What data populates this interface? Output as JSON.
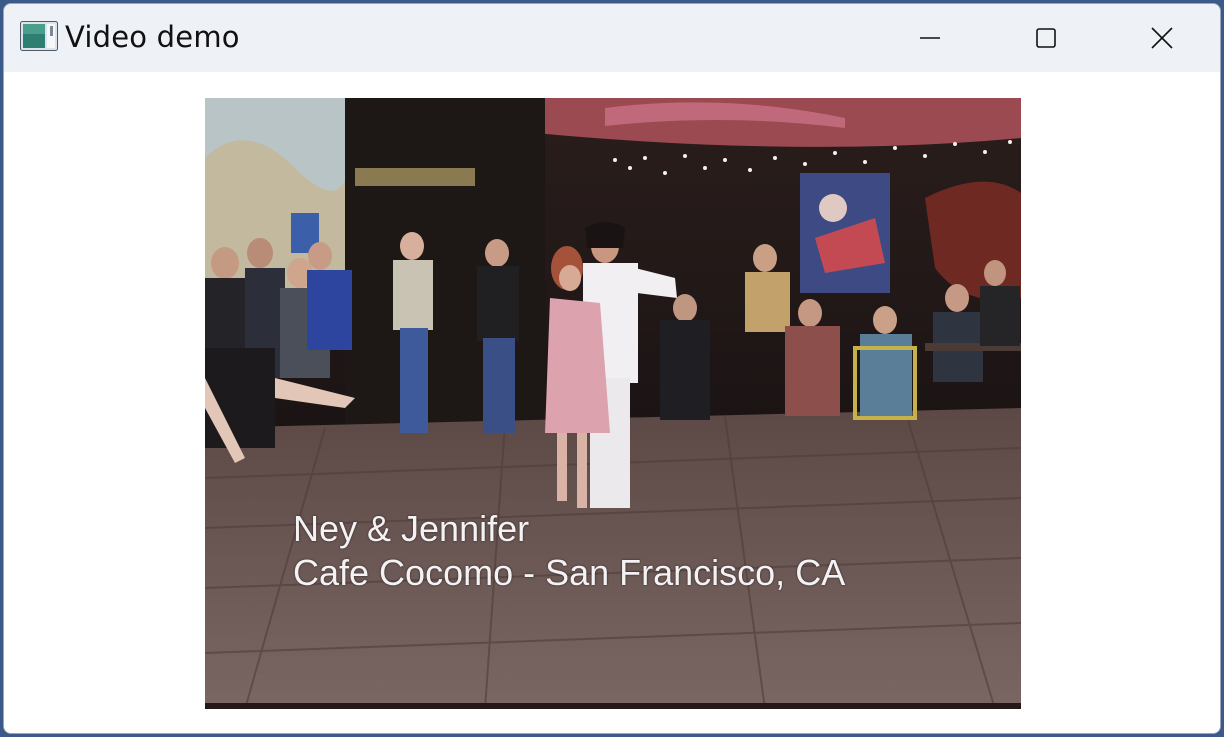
{
  "window": {
    "title": "Video demo",
    "app_icon": "video-app-icon",
    "controls": {
      "minimize": "minimize-icon",
      "maximize": "maximize-icon",
      "close": "close-icon"
    }
  },
  "video": {
    "caption_line_1": "Ney & Jennifer",
    "caption_line_2": "Cafe Cocomo - San Francisco, CA"
  },
  "colors": {
    "titlebar_bg": "#eef1f5",
    "window_bg": "#ffffff",
    "floor": "#6b5752"
  }
}
